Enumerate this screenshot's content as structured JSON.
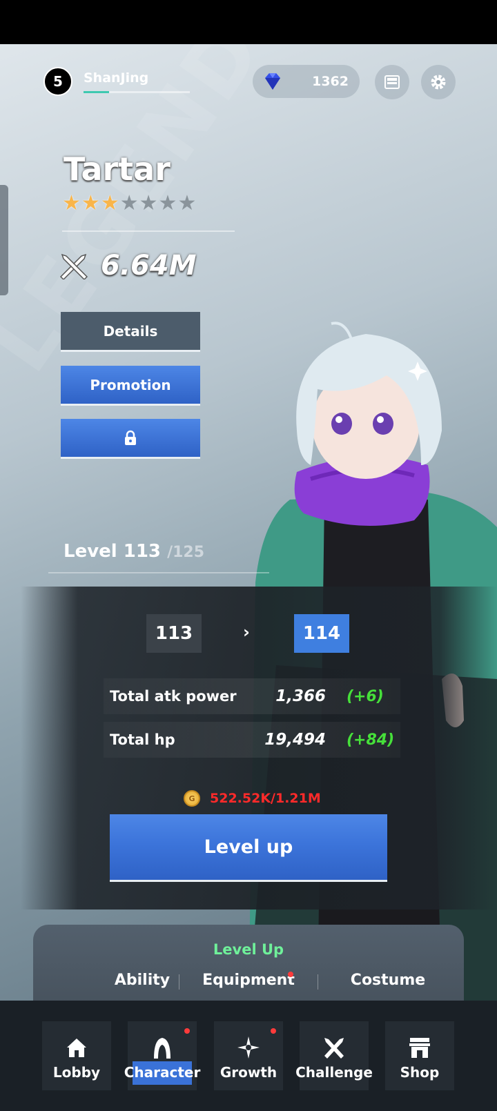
{
  "header": {
    "player_level": "5",
    "player_name": "ShanJing",
    "xp_progress": 0.24,
    "gems": "1362",
    "icons": [
      "gem-icon",
      "inbox-icon",
      "gear-icon"
    ]
  },
  "hero": {
    "name": "Tartar",
    "stars_filled": 3,
    "stars_total": 7,
    "combat_power": "6.64M"
  },
  "actions": {
    "details": "Details",
    "promotion": "Promotion",
    "locked_icon": "lock-icon"
  },
  "level": {
    "label": "Level 113",
    "max": "/125",
    "from": "113",
    "arrow": "›",
    "to": "114"
  },
  "stats": [
    {
      "label": "Total atk power",
      "value": "1,366",
      "delta": "(+6)"
    },
    {
      "label": "Total hp",
      "value": "19,494",
      "delta": "(+84)"
    }
  ],
  "cost": {
    "coin_letter": "G",
    "text": "522.52K/1.21M"
  },
  "level_up_button": "Level up",
  "subtabs": {
    "title": "Level Up",
    "items": [
      "Ability",
      "Equipment",
      "Costume"
    ]
  },
  "nav": {
    "items": [
      "Lobby",
      "Character",
      "Growth",
      "Challenge",
      "Shop"
    ]
  },
  "watermark": "LEGEND OF TARTAR",
  "colors": {
    "accent_blue": "#3f7fe0",
    "delta_green": "#46e03a",
    "cost_red": "#ff2a2a",
    "subtitle_green": "#6ff09a"
  }
}
